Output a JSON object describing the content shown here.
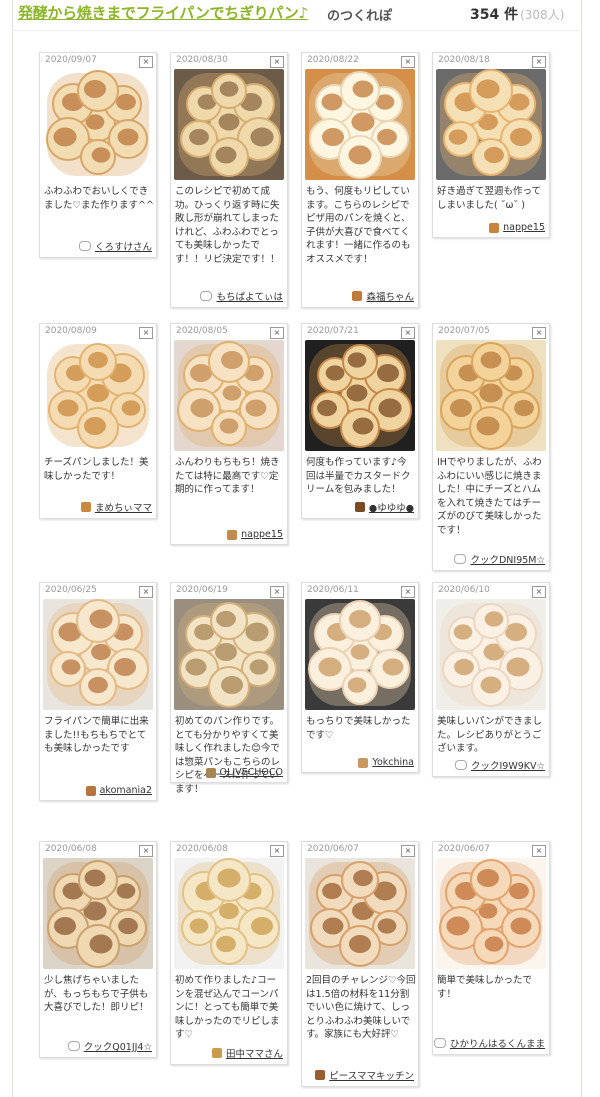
{
  "header": {
    "recipe_title": "発酵から焼きまでフライパンでちぎりパン♪",
    "tsukurepo_label": "のつくれぽ",
    "count": "354 件",
    "people": "(308人)"
  },
  "cards": [
    {
      "date": "2020/09/07",
      "close": "×",
      "comment": "ふわふわでおいしくできました♡また作ります^^",
      "author": "くろすけさん",
      "icon": "chat-icon"
    },
    {
      "date": "2020/08/30",
      "close": "×",
      "comment": "このレシピで初めて成功。ひっくり返す時に失敗し形が崩れてしまったけれど、ふわふわでとっても美味しかったです！！リピ決定です！！",
      "author": "もちぱよてぃは",
      "icon": "chat-icon"
    },
    {
      "date": "2020/08/22",
      "close": "×",
      "comment": "もう、何度もリピしています。こちらのレシピでピザ用のパンを焼くと、子供が大喜びで食べてくれます！一緒に作るのもオススメです！",
      "author": "森福ちゃん",
      "icon": "avatar-icon"
    },
    {
      "date": "2020/08/18",
      "close": "×",
      "comment": "好き過ぎて翌週も作ってしまいました( ˘ω˘ )",
      "author": "nappe15",
      "icon": "avatar-icon"
    },
    {
      "date": "2020/08/09",
      "close": "×",
      "comment": "チーズパンしました！美味しかったです！",
      "author": "まめちぃママ",
      "icon": "avatar-icon"
    },
    {
      "date": "2020/08/05",
      "close": "×",
      "comment": "ふんわりもちもち！焼きたては特に最高です♡定期的に作ってます！",
      "author": "nappe15",
      "icon": "avatar-icon"
    },
    {
      "date": "2020/07/21",
      "close": "×",
      "comment": "何度も作っています♪今回は半量でカスタードクリームを包みました！",
      "author": "●ゆゆゆ●",
      "icon": "avatar-icon"
    },
    {
      "date": "2020/07/05",
      "close": "×",
      "comment": "IHでやりましたが、ふわふわにいい感じに焼きました！中にチーズとハムを入れて焼きたてはチーズがのびて美味しかったです！",
      "author": "クックDNI95M☆",
      "icon": "chat-icon"
    },
    {
      "date": "2020/06/25",
      "close": "×",
      "comment": "フライパンで簡単に出来ました!!もちもちでとても美味しかったです",
      "author": "akomania2",
      "icon": "avatar-icon"
    },
    {
      "date": "2020/06/19",
      "close": "×",
      "comment": "初めてのパン作りです。とても分かりやすくて美味しく作れました😊今では惣菜パンもこちらのレシピをベースに作っています！",
      "author": "OLIVECHOCO",
      "icon": "avatar-icon"
    },
    {
      "date": "2020/06/11",
      "close": "×",
      "comment": "もっちりで美味しかったです♡",
      "author": "Yokchina",
      "icon": "avatar-icon"
    },
    {
      "date": "2020/06/10",
      "close": "×",
      "comment": "美味しいパンができました。レシピありがとうございます。",
      "author": "クックI9W9KV☆",
      "icon": "chat-icon"
    },
    {
      "date": "2020/06/08",
      "close": "×",
      "comment": "少し焦げちゃいましたが、もっちもちで子供も大喜びでした！即リピ！",
      "author": "クックQ01JJ4☆",
      "icon": "chat-icon"
    },
    {
      "date": "2020/06/08",
      "close": "×",
      "comment": "初めて作りました♪コーンを混ぜ込んでコーンパンに！とっても簡単で美味しかったのでリピします♡",
      "author": "田中ママさん",
      "icon": "avatar-icon"
    },
    {
      "date": "2020/06/07",
      "close": "×",
      "comment": "2回目のチャレンジ♡今回は1.5倍の材料を11分割でいい色に焼けて、しっとりふわふわ美味しいです。家族にも大好評♡",
      "author": "ピースママキッチン",
      "icon": "avatar-icon"
    },
    {
      "date": "2020/06/07",
      "close": "×",
      "comment": "簡単で美味しかったです！",
      "author": "ひかりんはるくんまま",
      "icon": "chat-icon"
    }
  ]
}
